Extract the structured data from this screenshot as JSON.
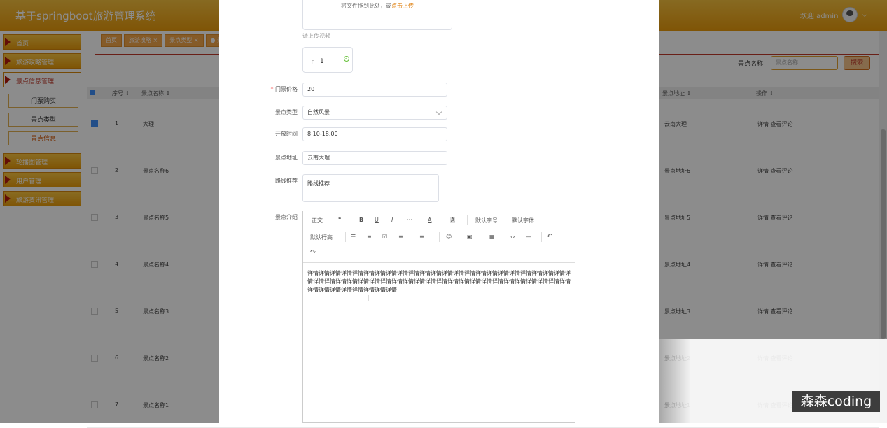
{
  "header": {
    "title": "基于springboot旅游管理系统",
    "user_text": "欢迎 admin",
    "user_arrow": "⌵"
  },
  "sidebar": {
    "items": [
      {
        "label": "首页",
        "active": false
      },
      {
        "label": "旅游攻略管理",
        "active": false
      },
      {
        "label": "景点信息管理",
        "active": true
      },
      {
        "label": "轮播图管理",
        "active": false
      },
      {
        "label": "用户管理",
        "active": false
      },
      {
        "label": "旅游资讯管理",
        "active": false
      }
    ],
    "subitems": [
      {
        "label": "门票购买"
      },
      {
        "label": "景点类型"
      },
      {
        "label": "景点信息"
      }
    ]
  },
  "tags": [
    "首页",
    "旅游攻略 ×",
    "景点类型 ×",
    "● 景"
  ],
  "search": {
    "label": "景点名称:",
    "placeholder": "景点名称",
    "button": "搜索"
  },
  "table": {
    "headers": {
      "index": "序号 ⇕",
      "name": "景点名称 ⇕",
      "address": "景点地址 ⇕",
      "action": "操作 ⇕"
    },
    "rows": [
      {
        "index": "1",
        "name": "大理",
        "address": "云南大理",
        "checked": true
      },
      {
        "index": "2",
        "name": "景点名称6",
        "address": "景点地址6",
        "checked": false
      },
      {
        "index": "3",
        "name": "景点名称5",
        "address": "景点地址5",
        "checked": false
      },
      {
        "index": "4",
        "name": "景点名称4",
        "address": "景点地址4",
        "checked": false
      },
      {
        "index": "5",
        "name": "景点名称3",
        "address": "景点地址3",
        "checked": false
      },
      {
        "index": "6",
        "name": "景点名称2",
        "address": "景点地址2",
        "checked": false
      },
      {
        "index": "7",
        "name": "景点名称1",
        "address": "景点地址1",
        "checked": false
      }
    ],
    "action_text": "详情 查看评论"
  },
  "dialog": {
    "upload_hint": "将文件拖到此处，或",
    "upload_link": "点击上传",
    "upload_label": "请上传视频",
    "file_name": "1",
    "price_label": "门票价格",
    "price_value": "20",
    "type_label": "景点类型",
    "type_value": "自然风景",
    "hours_label": "开放时间",
    "hours_value": "8.10-18.00",
    "address_label": "景点地址",
    "address_value": "云南大理",
    "route_label": "路线推荐",
    "route_value": "路线推荐",
    "intro_label": "景点介绍",
    "toolbar": {
      "para": "正文",
      "quote": "❝",
      "bold": "B",
      "underline": "U",
      "italic": "I",
      "more": "···",
      "fontcolor": "A",
      "bgcolor": "A",
      "fontsize": "默认字号",
      "fontfamily": "默认字体",
      "lineheight": "默认行高",
      "bullet": "☰",
      "numlist": "≡",
      "todo": "☑",
      "align": "≡",
      "indent": "≡",
      "emoji": "☺",
      "image": "▣",
      "table": "▦",
      "code": "‹›",
      "divider": "—",
      "undo": "↶",
      "redo": "↷"
    },
    "content": "详情详情详情详情详情详情详情详情详情详情详情详情详情详情详情详情详情详情详情详情详情详情详情详情详情详情详情详情详情详情详情详情详情详情详情详情详情详情详情详情详情详情详情详情详情详情详情详情详情详情详情详情详情详情详情"
  },
  "watermark": "森森coding"
}
